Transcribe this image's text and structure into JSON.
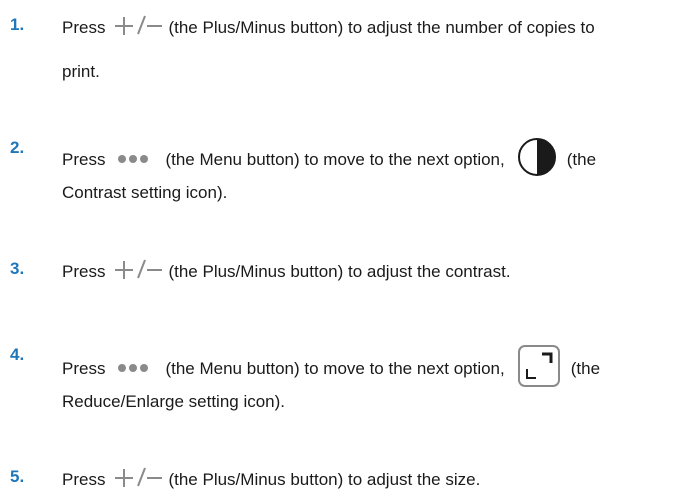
{
  "steps": [
    {
      "number": "1.",
      "press": "Press",
      "icon": "plus-minus-icon",
      "text": "(the Plus/Minus button) to adjust the number of copies to",
      "continuation": "print."
    },
    {
      "number": "2.",
      "press": "Press",
      "icon": "menu-dots-icon",
      "text": "(the Menu button) to move to the next option,",
      "icon2": "contrast-icon",
      "tail": "(the",
      "continuation": "Contrast setting icon)."
    },
    {
      "number": "3.",
      "press": "Press",
      "icon": "plus-minus-icon",
      "text": "(the Plus/Minus button) to adjust the contrast."
    },
    {
      "number": "4.",
      "press": "Press",
      "icon": "menu-dots-icon",
      "text": "(the Menu button) to move to the next option,",
      "icon2": "reduce-enlarge-icon",
      "tail": "(the",
      "continuation": "Reduce/Enlarge setting icon)."
    },
    {
      "number": "5.",
      "press": "Press",
      "icon": "plus-minus-icon",
      "text": "(the Plus/Minus button) to adjust the size."
    }
  ],
  "colors": {
    "step_number": "#1f76b8",
    "icon_gray": "#8a8a8a",
    "text": "#1a1a1a"
  }
}
